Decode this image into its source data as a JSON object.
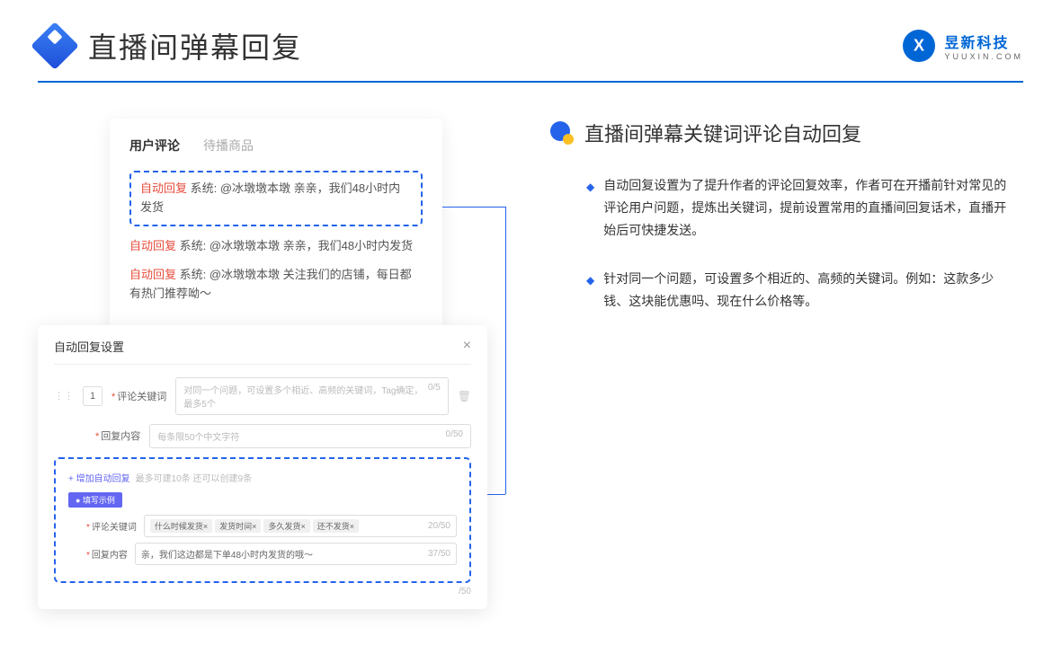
{
  "header": {
    "title": "直播间弹幕回复",
    "brand_cn": "昱新科技",
    "brand_en": "YUUXIN.COM"
  },
  "panel_top": {
    "tab1": "用户评论",
    "tab2": "待播商品",
    "highlighted": "自动回复 系统: @冰墩墩本墩 亲亲，我们48小时内发货",
    "c2": "自动回复 系统: @冰墩墩本墩 亲亲，我们48小时内发货",
    "c3": "自动回复 系统: @冰墩墩本墩 关注我们的店铺，每日都有热门推荐呦～",
    "reply_prefix": "自动回复"
  },
  "modal": {
    "title": "自动回复设置",
    "close": "×",
    "idx": "1",
    "label_keyword": "评论关键词",
    "ph_keyword": "对同一个问题，可设置多个相近、高频的关键词，Tag确定，最多5个",
    "count_kw": "0/5",
    "label_content": "回复内容",
    "ph_content": "每条限50个中文字符",
    "count_ct": "0/50",
    "add_link": "+ 增加自动回复",
    "add_hint": "最多可建10条 还可以创建9条",
    "example_tag": "● 填写示例",
    "ex_kw": "评论关键词",
    "ex_tags": [
      "什么时候发货×",
      "发货时间×",
      "多久发货×",
      "还不发货×"
    ],
    "ex_kw_count": "20/50",
    "ex_ct": "回复内容",
    "ex_ct_val": "亲，我们这边都是下单48小时内发货的哦～",
    "ex_ct_count": "37/50",
    "outer_count": "/50"
  },
  "right": {
    "section_title": "直播间弹幕关键词评论自动回复",
    "p1": "自动回复设置为了提升作者的评论回复效率，作者可在开播前针对常见的评论用户问题，提炼出关键词，提前设置常用的直播间回复话术，直播开始后可快捷发送。",
    "p2": "针对同一个问题，可设置多个相近的、高频的关键词。例如：这款多少钱、这块能优惠吗、现在什么价格等。"
  }
}
